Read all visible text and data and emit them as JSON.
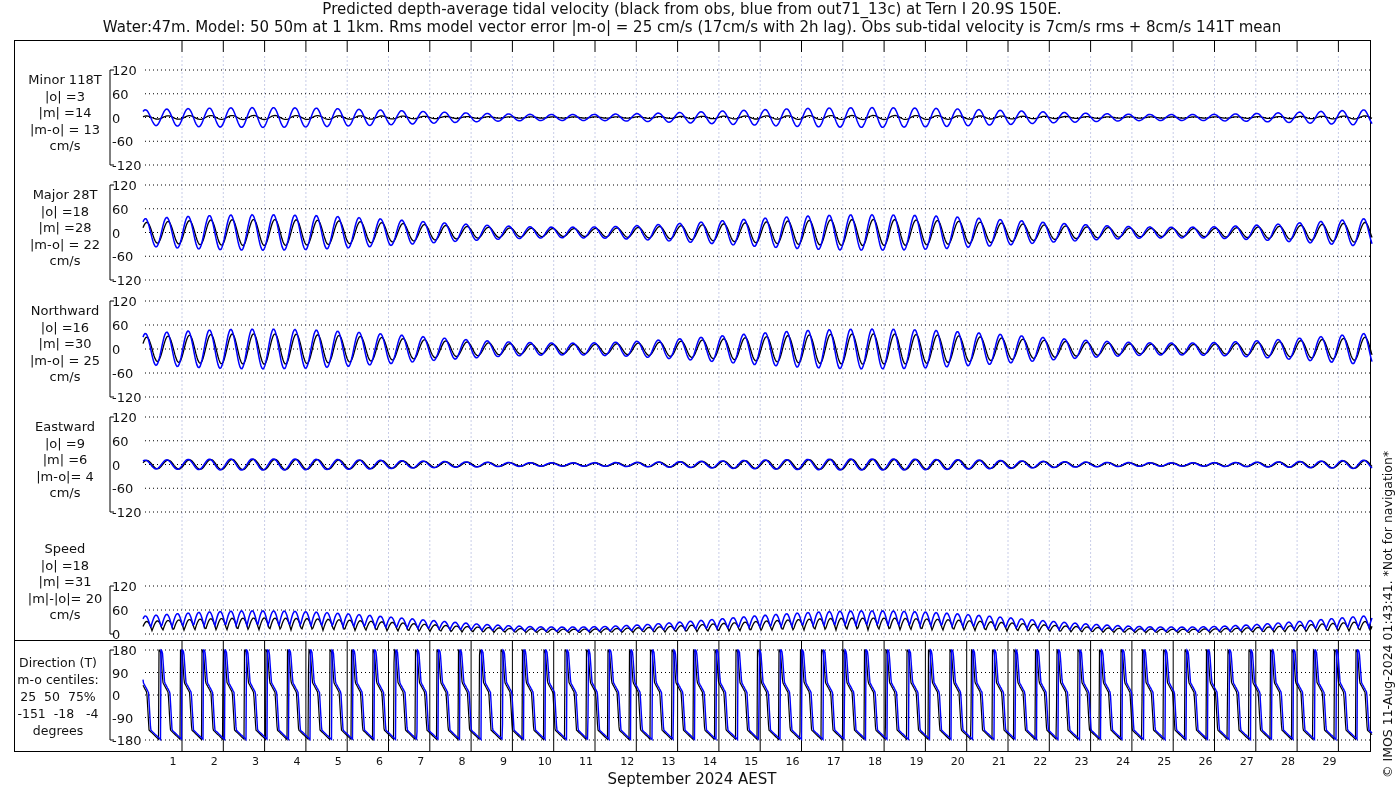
{
  "title_lines": [
    "Predicted depth-average tidal velocity (black from obs, blue from out71_13c) at Tern I 20.9S 150E.",
    "Water:47m. Model: 50 50m at 1 1km. Rms model vector error |m-o| = 25 cm/s (17cm/s with 2h lag). Obs sub-tidal velocity is 7cm/s rms + 8cm/s 141T mean"
  ],
  "panels": [
    {
      "kind": "velocity",
      "label_lines": [
        "Minor 118T",
        "|o| =3",
        "|m| =14",
        "|m-o| = 13",
        "cm/s"
      ],
      "yticks": [
        "120",
        "60",
        "0",
        "-60",
        "-120"
      ]
    },
    {
      "kind": "velocity",
      "label_lines": [
        "Major 28T",
        "|o| =18",
        "|m| =28",
        "|m-o| = 22",
        "cm/s"
      ],
      "yticks": [
        "120",
        "60",
        "0",
        "-60",
        "-120"
      ]
    },
    {
      "kind": "velocity",
      "label_lines": [
        "Northward",
        "|o| =16",
        "|m| =30",
        "|m-o| = 25",
        "cm/s"
      ],
      "yticks": [
        "120",
        "60",
        "0",
        "-60",
        "-120"
      ]
    },
    {
      "kind": "velocity",
      "label_lines": [
        "Eastward",
        "|o| =9",
        "|m| =6",
        "|m-o|= 4",
        "cm/s"
      ],
      "yticks": [
        "120",
        "60",
        "0",
        "-60",
        "-120"
      ]
    },
    {
      "kind": "speed",
      "label_lines": [
        "Speed",
        "|o| =18",
        "|m| =31",
        "|m|-|o|= 20",
        "cm/s"
      ],
      "yticks": [
        "120",
        "60",
        "0"
      ]
    }
  ],
  "direction_panel": {
    "label_lines": [
      "Direction (T)",
      "m-o centiles:",
      "25  50  75%",
      "-151  -18   -4",
      "degrees"
    ],
    "yticks": [
      "180",
      "90",
      "0",
      "-90",
      "-180"
    ]
  },
  "x_axis": {
    "ticks": [
      "1",
      "2",
      "3",
      "4",
      "5",
      "6",
      "7",
      "8",
      "9",
      "10",
      "11",
      "12",
      "13",
      "14",
      "15",
      "16",
      "17",
      "18",
      "19",
      "20",
      "21",
      "22",
      "23",
      "24",
      "25",
      "26",
      "27",
      "28",
      "29"
    ],
    "label": "September 2024 AEST"
  },
  "credit": "© IMOS 11-Aug-2024 01:43:41. *Not for navigation*"
}
